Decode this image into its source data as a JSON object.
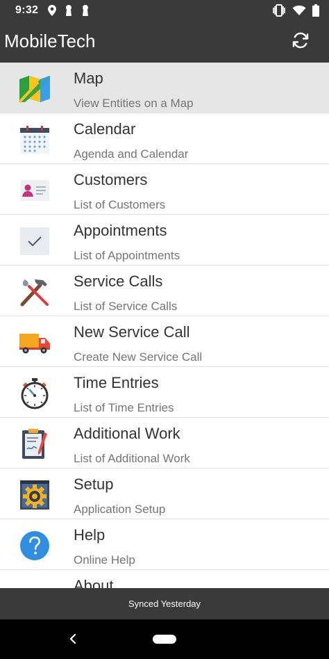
{
  "status_bar": {
    "time": "9:32",
    "left_icons": [
      "location-icon",
      "keyhole-icon",
      "keyhole-icon"
    ],
    "right_icons": [
      "vibrate-icon",
      "wifi-icon",
      "battery-icon"
    ]
  },
  "app_bar": {
    "title": "MobileTech",
    "sync_icon": "sync-icon"
  },
  "menu": {
    "items": [
      {
        "title": "Map",
        "subtitle": "View Entities on a Map",
        "icon": "map-icon",
        "selected": true
      },
      {
        "title": "Calendar",
        "subtitle": "Agenda and Calendar",
        "icon": "calendar-icon",
        "selected": false
      },
      {
        "title": "Customers",
        "subtitle": "List of Customers",
        "icon": "customer-card-icon",
        "selected": false
      },
      {
        "title": "Appointments",
        "subtitle": "List of Appointments",
        "icon": "checkmark-icon",
        "selected": false
      },
      {
        "title": "Service Calls",
        "subtitle": "List of Service Calls",
        "icon": "tools-icon",
        "selected": false
      },
      {
        "title": "New Service Call",
        "subtitle": "Create New Service Call",
        "icon": "truck-icon",
        "selected": false
      },
      {
        "title": "Time Entries",
        "subtitle": "List of Time Entries",
        "icon": "stopwatch-icon",
        "selected": false
      },
      {
        "title": "Additional Work",
        "subtitle": "List of Additional Work",
        "icon": "clipboard-icon",
        "selected": false
      },
      {
        "title": "Setup",
        "subtitle": "Application Setup",
        "icon": "gear-icon",
        "selected": false
      },
      {
        "title": "Help",
        "subtitle": "Online Help",
        "icon": "help-icon",
        "selected": false
      },
      {
        "title": "About",
        "subtitle": "",
        "icon": "about-icon",
        "selected": false
      }
    ]
  },
  "footer": {
    "sync_status": "Synced Yesterday"
  },
  "colors": {
    "bar_background": "#3a3a3a",
    "selected_row": "#e6e6e6",
    "divider": "#e0e0e0",
    "help_blue": "#2f8ee0"
  }
}
